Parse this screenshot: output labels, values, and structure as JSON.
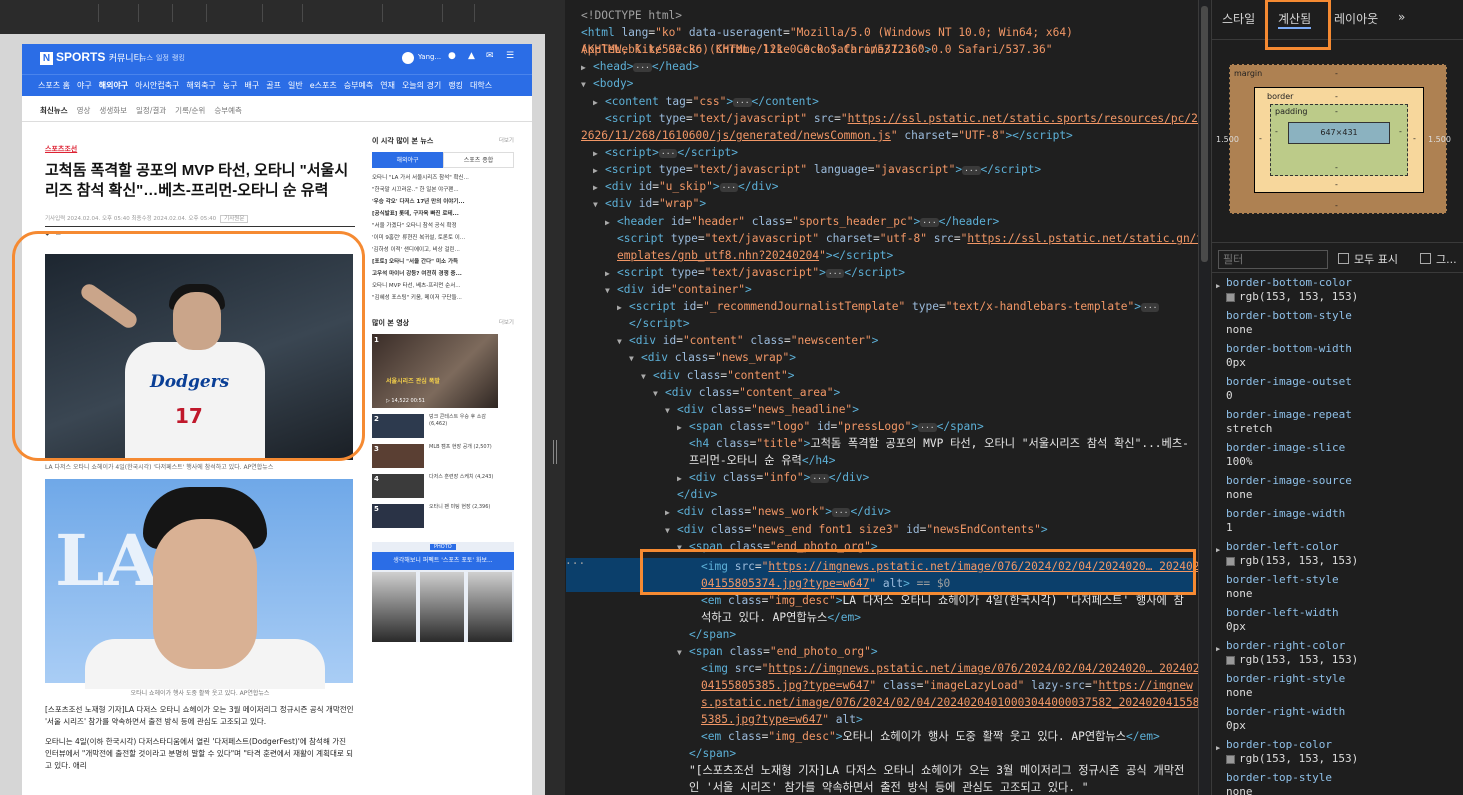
{
  "browser_page": {
    "logo": "SPORTS",
    "logo_box": "N",
    "community": "커뮤니티",
    "top_small": [
      "뉴스",
      "일정",
      "랭킹"
    ],
    "user": "Yang...",
    "nav_main": [
      "스포츠 홈",
      "야구",
      "해외야구",
      "아시안컵축구",
      "해외축구",
      "농구",
      "배구",
      "골프",
      "일반",
      "e스포츠",
      "승부예측",
      "연재",
      "오늘의 경기",
      "랭킹",
      "대학스"
    ],
    "nav_sub": [
      "최신뉴스",
      "영상",
      "생생화보",
      "일정/결과",
      "기록/순위",
      "승부예측"
    ],
    "press_logo": "스포츠조선",
    "headline": "고척돔 폭격할 공포의 MVP 타선, 오타니 \"서울시리즈 참석 확신\"…베츠-프리먼-오타니 순 유력",
    "info": "기사입력 2024.02.04. 오후 05:40   최종수정 2024.02.04. 오후 05:40",
    "info_badge": "기사원문",
    "photo1_team": "Dodgers",
    "photo1_number": "17",
    "caption1": "LA 다저스 오타니 쇼헤이가 4일(한국시각) '다저페스트' 행사에 참석하고 있다. AP연합뉴스",
    "photo2_letters": "LA",
    "caption2": "오타니 쇼헤이가 행사 도중 활짝 웃고 있다. AP연합뉴스",
    "body_paragraphs": [
      "[스포츠조선 노재형 기자]LA 다저스 오타니 쇼헤이가 오는 3월 메이저리그 정규시즌 공식 개막전인 '서울 시리즈' 참가를 약속하면서 출전 방식 등에 관심도 고조되고 있다.",
      "오타니는 4일(이하 한국시각) 다저스타디움에서 열린 '다저페스트(DodgerFest)'에 참석해 가진 인터뷰에서 \"개막전에 출전할 것이라고 분명히 말할 수 있다\"며 \"타격 훈련에서 재활이 계획대로 되고 있다. 애리"
    ],
    "sidebar": {
      "popular_title": "이 시각 많이 본 뉴스",
      "more": "더보기",
      "tabs": [
        "해외야구",
        "스포츠 종합"
      ],
      "popular_items": [
        "오타니 \"LA 가서 서울시리즈 참석\" 확신...",
        "\"한국말 시끄러운..\" 한 일본 야구팬...",
        "'우승 각오' 다저스 17년 만의 이야기...",
        "[공식발표] 롯데, 구자욱 빠진 로테...",
        "\"서울 가겠다\" 오타니 참석 공식 확정",
        "'이미 9홈런' 류현진 복귀설, 토론토 이...",
        "'김하성 이적' 샌디에이고, 비상 걸린...",
        "[포토] 오타니 \"서울 간다\" 미소 가득",
        "고우석 마이너 강등? 여전히 경쟁 중...",
        "오타니 MVP 타선, 베츠-프리먼 순서...",
        "\"김혜성 포스팅\" 키움, 메이저 구단들..."
      ],
      "video_title": "많이 본 영상",
      "video_big_title": "서울시리즈 관심 폭발",
      "video_big_meta": "▷ 14,522   00:51",
      "videos": [
        {
          "rank": "1",
          "text": "많이 본 영상 1위"
        },
        {
          "rank": "2",
          "text": "덩크 콘테스트 우승 후 소감 (6,462)"
        },
        {
          "rank": "3",
          "text": "MLB 캠프 현장 공개 (2,507)"
        },
        {
          "rank": "4",
          "text": "다저스 훈련장 스케치 (4,243)"
        },
        {
          "rank": "5",
          "text": "오타니 팬 미팅 현장 (2,396)"
        }
      ],
      "banner_tag": "PHOTO",
      "banner_title": "생각해보니 퍼펙트 '스포츠 포토' 화보..."
    }
  },
  "elements_panel": {
    "lines": [
      "<!DOCTYPE html>",
      "html",
      "head",
      "body",
      "content tag css",
      "script newsCommon",
      "script",
      "script javascript",
      "div u_skip",
      "div wrap",
      "header",
      "script gnb",
      "script",
      "div container",
      "script template",
      "div content",
      "div news_wrap",
      "div content",
      "div content_area",
      "div news_headline",
      "span logo",
      "h4 title",
      "div info",
      "div news_work",
      "div news_end",
      "span end_photo_org",
      "img",
      "em",
      "span end",
      "span end_photo_org",
      "img 2",
      "em 2",
      "span end 2",
      "body text"
    ],
    "doctype": "<!DOCTYPE html>",
    "html_lang": "ko",
    "useragent": "Mozilla/5.0 (Windows NT 10.0; Win64; x64) AppleWebKit/537.36 (KHTML, like Gecko) Chrome/121.0.0.0 Safari/537.36",
    "css_tag": "css",
    "news_common_src": "https://ssl.pstatic.net/static.sports/resources/pc/262626/11/268/1610600/js/generated/newsCommon.js",
    "charset_utf8": "UTF-8",
    "gnb_src": "https://ssl.pstatic.net/static.gn/templates/gnb_utf8.nhn?20240204",
    "template_id": "_recommendJournalistTemplate",
    "h4_text": "고척돔 폭격할 공포의 MVP 타선, 오타니 \"서울시리즈 참석 확신\"...베츠-프리먼-오타니 순 유력",
    "img1_src": "https://imgnews.pstatic.net/image/076/2024/02/04/2024020… 20240204155805374.jpg?type=w647",
    "img1_tail": "== $0",
    "em1_text": "LA 다저스 오타니 쇼헤이가 4일(한국시각) '다저페스트' 행사에 참석하고 있다. AP연합뉴스",
    "img2_src": "https://imgnews.pstatic.net/image/076/2024/02/04/2024020… 20240204155805385.jpg?type=w647",
    "img2_lazy": "https://imgnews.pstatic.net/image/076/2024/02/04/20240204010003044000037582_20240204155805385.jpg?type=w647",
    "em2_text": "오타니 쇼헤이가 행사 도중 활짝 웃고 있다. AP연합뉴스",
    "body_text": "\"[스포츠조선 노재형 기자]LA 다저스 오타니 쇼헤이가 오는 3월 메이저리그 정규시즌 공식 개막전인 '서울 시리즈' 참가를 약속하면서 출전 방식 등에 관심도 고조되고 있다. \""
  },
  "styles_panel": {
    "tabs": [
      "스타일",
      "계산됨",
      "레이아웃",
      "»"
    ],
    "active_tab": "계산됨",
    "box_model": {
      "margin_label": "margin",
      "border_label": "border",
      "padding_label": "padding",
      "content": "647×431",
      "margin_left": "1.500",
      "margin_right": "1.500",
      "dash": "-"
    },
    "filter_placeholder": "필터",
    "show_all": "모두 표시",
    "group": "그...",
    "properties": [
      {
        "name": "border-bottom-color",
        "value": "rgb(153, 153, 153)",
        "swatch": true,
        "tri": true
      },
      {
        "name": "border-bottom-style",
        "value": "none"
      },
      {
        "name": "border-bottom-width",
        "value": "0px"
      },
      {
        "name": "border-image-outset",
        "value": "0"
      },
      {
        "name": "border-image-repeat",
        "value": "stretch"
      },
      {
        "name": "border-image-slice",
        "value": "100%"
      },
      {
        "name": "border-image-source",
        "value": "none"
      },
      {
        "name": "border-image-width",
        "value": "1"
      },
      {
        "name": "border-left-color",
        "value": "rgb(153, 153, 153)",
        "swatch": true,
        "tri": true
      },
      {
        "name": "border-left-style",
        "value": "none"
      },
      {
        "name": "border-left-width",
        "value": "0px"
      },
      {
        "name": "border-right-color",
        "value": "rgb(153, 153, 153)",
        "swatch": true,
        "tri": true
      },
      {
        "name": "border-right-style",
        "value": "none"
      },
      {
        "name": "border-right-width",
        "value": "0px"
      },
      {
        "name": "border-top-color",
        "value": "rgb(153, 153, 153)",
        "swatch": true,
        "tri": true
      },
      {
        "name": "border-top-style",
        "value": "none"
      }
    ]
  },
  "colors": {
    "highlight": "#f58a32",
    "brand_blue": "#2b6de6",
    "selected_row": "#0b3f6b"
  }
}
